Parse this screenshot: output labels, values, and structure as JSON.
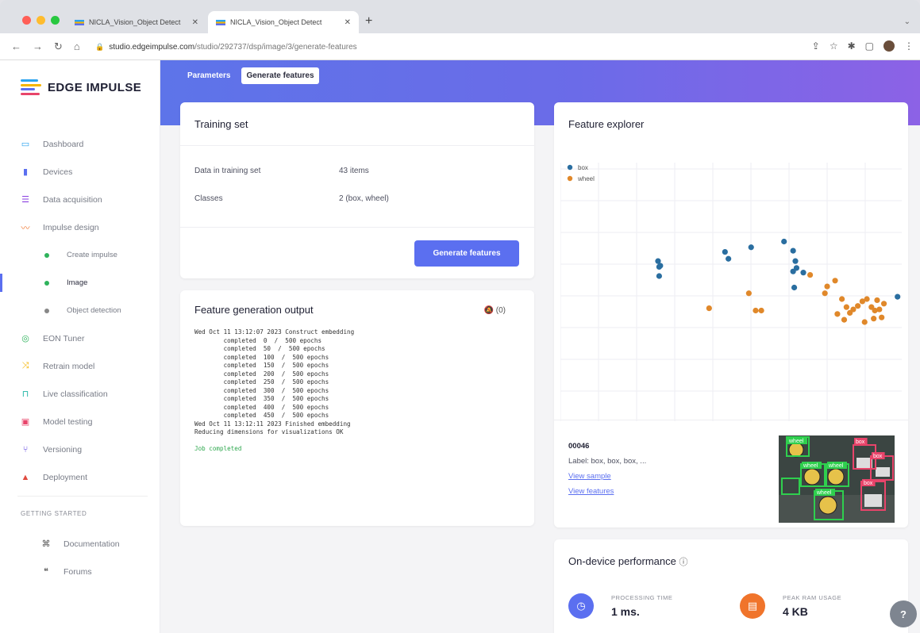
{
  "browser": {
    "tabs": [
      {
        "title": "NICLA_Vision_Object Detect"
      },
      {
        "title": "NICLA_Vision_Object Detect"
      }
    ],
    "url_host": "studio.edgeimpulse.com",
    "url_path": "/studio/292737/dsp/image/3/generate-features"
  },
  "brand": {
    "name": "EDGE IMPULSE",
    "accent": "#5b6ff0"
  },
  "sidebar": {
    "items": [
      {
        "label": "Dashboard",
        "icon": "monitor-icon",
        "color": "#2aa3ef"
      },
      {
        "label": "Devices",
        "icon": "device-icon",
        "color": "#5b6ff0"
      },
      {
        "label": "Data acquisition",
        "icon": "database-icon",
        "color": "#8a3fe0"
      },
      {
        "label": "Impulse design",
        "icon": "pulse-icon",
        "color": "#f0742b"
      },
      {
        "label": "Create impulse",
        "icon": "dot-icon",
        "color": "#2fb35c"
      },
      {
        "label": "Image",
        "icon": "dot-icon",
        "color": "#2fb35c"
      },
      {
        "label": "Object detection",
        "icon": "dot-icon",
        "color": "#888"
      },
      {
        "label": "EON Tuner",
        "icon": "tuner-icon",
        "color": "#2fb35c"
      },
      {
        "label": "Retrain model",
        "icon": "shuffle-icon",
        "color": "#f6b500"
      },
      {
        "label": "Live classification",
        "icon": "live-icon",
        "color": "#1fb5a5"
      },
      {
        "label": "Model testing",
        "icon": "testing-icon",
        "color": "#e8446a"
      },
      {
        "label": "Versioning",
        "icon": "branch-icon",
        "color": "#5b3fe0"
      },
      {
        "label": "Deployment",
        "icon": "rocket-icon",
        "color": "#e04a3f"
      }
    ],
    "getting_started": "GETTING STARTED",
    "help": [
      {
        "label": "Documentation",
        "icon": "docs-icon"
      },
      {
        "label": "Forums",
        "icon": "forums-icon"
      }
    ]
  },
  "header": {
    "tabs": [
      "Parameters",
      "Generate features"
    ]
  },
  "training_set": {
    "title": "Training set",
    "rows": [
      {
        "key": "Data in training set",
        "value": "43 items"
      },
      {
        "key": "Classes",
        "value": "2 (box, wheel)"
      }
    ],
    "button": "Generate features"
  },
  "output": {
    "title": "Feature generation output",
    "control": "(0)",
    "lines": [
      "Wed Oct 11 13:12:07 2023 Construct embedding",
      "        completed  0  /  500 epochs",
      "        completed  50  /  500 epochs",
      "        completed  100  /  500 epochs",
      "        completed  150  /  500 epochs",
      "        completed  200  /  500 epochs",
      "        completed  250  /  500 epochs",
      "        completed  300  /  500 epochs",
      "        completed  350  /  500 epochs",
      "        completed  400  /  500 epochs",
      "        completed  450  /  500 epochs",
      "Wed Oct 11 13:12:11 2023 Finished embedding",
      "Reducing dimensions for visualizations OK"
    ],
    "status": "Job completed"
  },
  "explorer": {
    "title": "Feature explorer",
    "sample_id": "00046",
    "label": "Label: box, box, box, ...",
    "link_sample": "View sample",
    "link_features": "View features",
    "thumb_labels": [
      "wheel",
      "box",
      "wheel",
      "wheel",
      "box",
      "box",
      "wheel"
    ]
  },
  "chart_data": {
    "type": "scatter",
    "legend": "top-left",
    "grid": true,
    "series": [
      {
        "name": "box",
        "color": "#2a6ea0",
        "x": [
          86,
          87,
          88,
          87,
          145,
          148,
          168,
          197,
          205,
          207,
          208,
          205,
          214,
          206,
          297
        ],
        "y": [
          87,
          92,
          91,
          100,
          79,
          85,
          75,
          70,
          78,
          87,
          93,
          96,
          97,
          110,
          118
        ]
      },
      {
        "name": "wheel",
        "color": "#e0882a",
        "x": [
          131,
          166,
          172,
          177,
          220,
          235,
          242,
          233,
          248,
          252,
          255,
          262,
          266,
          270,
          274,
          277,
          279,
          281,
          283,
          285,
          268,
          276,
          258,
          244,
          250
        ],
        "y": [
          128,
          115,
          130,
          130,
          99,
          109,
          104,
          115,
          120,
          127,
          132,
          126,
          122,
          120,
          127,
          130,
          121,
          129,
          136,
          124,
          140,
          137,
          129,
          133,
          138
        ]
      }
    ]
  },
  "performance": {
    "title": "On-device performance",
    "metrics": [
      {
        "label": "PROCESSING TIME",
        "value": "1 ms.",
        "color": "#5b6ff0",
        "icon": "clock-icon"
      },
      {
        "label": "PEAK RAM USAGE",
        "value": "4 KB",
        "color": "#f0742b",
        "icon": "ram-icon"
      }
    ]
  }
}
